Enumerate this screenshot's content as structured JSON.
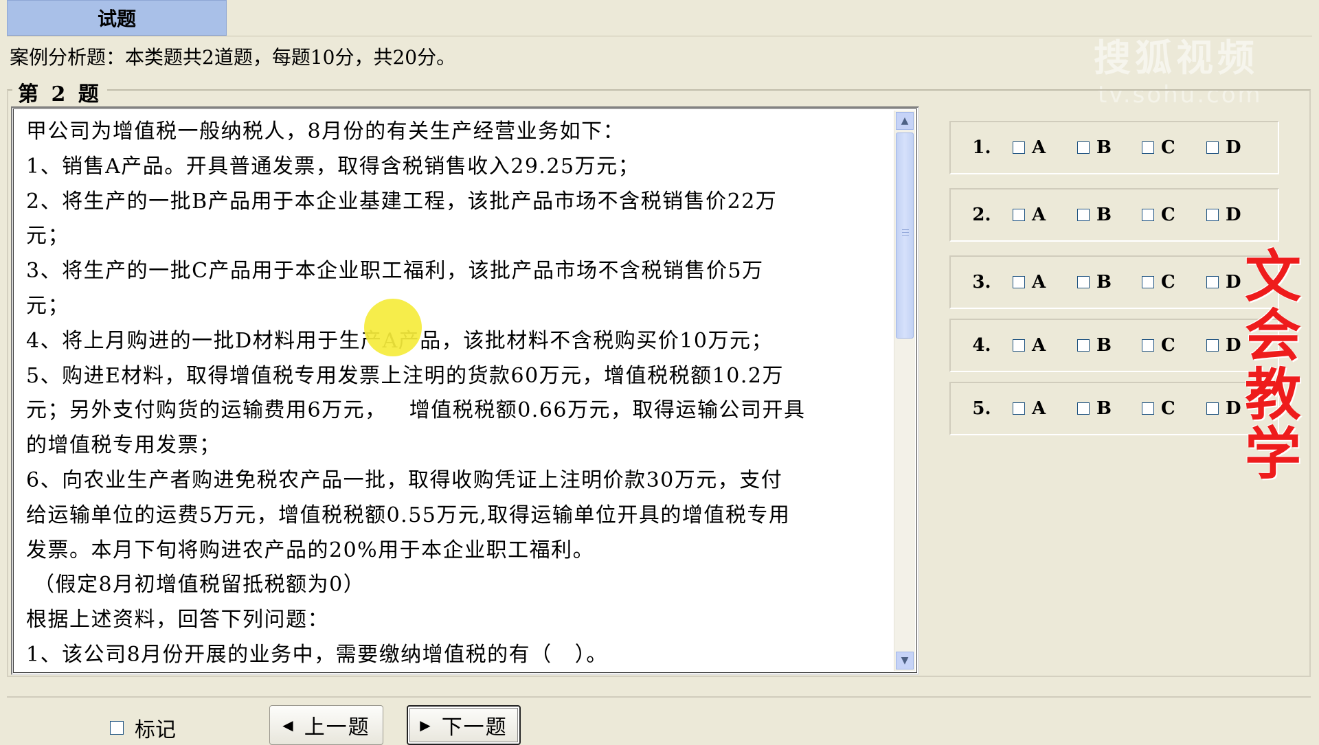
{
  "tab": {
    "label": "试题"
  },
  "intro": "案例分析题：本类题共2道题，每题10分，共20分。",
  "question_number": "第 2 题",
  "question_lines": [
    "甲公司为增值税一般纳税人，8月份的有关生产经营业务如下：",
    "1、销售A产品。开具普通发票，取得含税销售收入29.25万元；",
    "2、将生产的一批B产品用于本企业基建工程，该批产品市场不含税销售价22万",
    "元；",
    "3、将生产的一批C产品用于本企业职工福利，该批产品市场不含税销售价5万",
    "元；",
    "4、将上月购进的一批D材料用于生产A产品，该批材料不含税购买价10万元；",
    "5、购进E材料，取得增值税专用发票上注明的货款60万元，增值税税额10.2万",
    "元；另外支付购货的运输费用6万元，   增值税税额0.66万元，取得运输公司开具",
    "的增值税专用发票；",
    "6、向农业生产者购进免税农产品一批，取得收购凭证上注明价款30万元，支付",
    "给运输单位的运费5万元，增值税税额0.55万元,取得运输单位开具的增值税专用",
    "发票。本月下旬将购进农产品的20%用于本企业职工福利。",
    " （假定8月初增值税留抵税额为0）",
    "根据上述资料，回答下列问题：",
    "1、该公司8月份开展的业务中，需要缴纳增值税的有（   ）。"
  ],
  "answers": [
    {
      "num": "1.",
      "options": [
        "A",
        "B",
        "C",
        "D"
      ]
    },
    {
      "num": "2.",
      "options": [
        "A",
        "B",
        "C",
        "D"
      ]
    },
    {
      "num": "3.",
      "options": [
        "A",
        "B",
        "C",
        "D"
      ]
    },
    {
      "num": "4.",
      "options": [
        "A",
        "B",
        "C",
        "D"
      ]
    },
    {
      "num": "5.",
      "options": [
        "A",
        "B",
        "C",
        "D"
      ]
    }
  ],
  "watermark": {
    "main": "搜狐视频",
    "sub": "tv.sohu.com"
  },
  "stamp": "文会教学",
  "footer": {
    "mark_label": "标记",
    "prev_label": "上一题",
    "next_label": "下一题"
  },
  "icons": {
    "scroll_up": "arrow-up-icon",
    "scroll_down": "arrow-down-icon",
    "prev": "triangle-left-icon",
    "next": "triangle-right-icon"
  },
  "colors": {
    "background": "#ece9d8",
    "tab": "#a9c0e8",
    "stamp": "#ee1c1c",
    "cursor_highlight": "#f5ec3c"
  }
}
